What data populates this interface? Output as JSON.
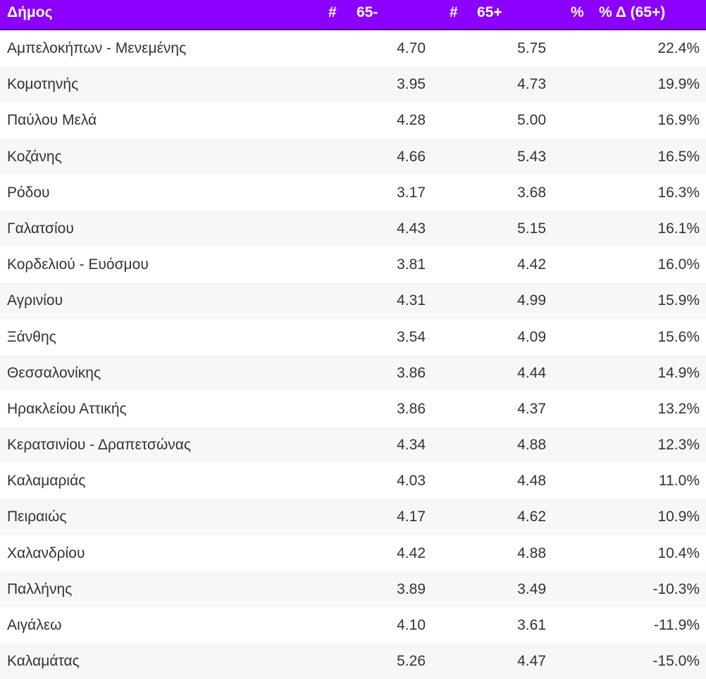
{
  "colors": {
    "header_bg": "#8b00ff",
    "header_text": "#ffffff",
    "row_alt": "#f6f7f9",
    "text": "#333333"
  },
  "chart_data": {
    "type": "table",
    "columns": [
      {
        "label": "Δήμος",
        "prefix": ""
      },
      {
        "label": "65-",
        "prefix": "#"
      },
      {
        "label": "65+",
        "prefix": "#"
      },
      {
        "label": "% Δ (65+)",
        "prefix": "%"
      }
    ],
    "rows": [
      {
        "name": "Αμπελοκήπων - Μενεμένης",
        "v1": "4.70",
        "v2": "5.75",
        "v3": "22.4%"
      },
      {
        "name": "Κομοτηνής",
        "v1": "3.95",
        "v2": "4.73",
        "v3": "19.9%"
      },
      {
        "name": "Παύλου Μελά",
        "v1": "4.28",
        "v2": "5.00",
        "v3": "16.9%"
      },
      {
        "name": "Κοζάνης",
        "v1": "4.66",
        "v2": "5.43",
        "v3": "16.5%"
      },
      {
        "name": "Ρόδου",
        "v1": "3.17",
        "v2": "3.68",
        "v3": "16.3%"
      },
      {
        "name": "Γαλατσίου",
        "v1": "4.43",
        "v2": "5.15",
        "v3": "16.1%"
      },
      {
        "name": "Κορδελιού - Ευόσμου",
        "v1": "3.81",
        "v2": "4.42",
        "v3": "16.0%"
      },
      {
        "name": "Αγρινίου",
        "v1": "4.31",
        "v2": "4.99",
        "v3": "15.9%"
      },
      {
        "name": "Ξάνθης",
        "v1": "3.54",
        "v2": "4.09",
        "v3": "15.6%"
      },
      {
        "name": "Θεσσαλονίκης",
        "v1": "3.86",
        "v2": "4.44",
        "v3": "14.9%"
      },
      {
        "name": "Ηρακλείου Αττικής",
        "v1": "3.86",
        "v2": "4.37",
        "v3": "13.2%"
      },
      {
        "name": "Κερατσινίου - Δραπετσώνας",
        "v1": "4.34",
        "v2": "4.88",
        "v3": "12.3%"
      },
      {
        "name": "Καλαμαριάς",
        "v1": "4.03",
        "v2": "4.48",
        "v3": "11.0%"
      },
      {
        "name": "Πειραιώς",
        "v1": "4.17",
        "v2": "4.62",
        "v3": "10.9%"
      },
      {
        "name": "Χαλανδρίου",
        "v1": "4.42",
        "v2": "4.88",
        "v3": "10.4%"
      },
      {
        "name": "Παλλήνης",
        "v1": "3.89",
        "v2": "3.49",
        "v3": "-10.3%"
      },
      {
        "name": "Αιγάλεω",
        "v1": "4.10",
        "v2": "3.61",
        "v3": "-11.9%"
      },
      {
        "name": "Καλαμάτας",
        "v1": "5.26",
        "v2": "4.47",
        "v3": "-15.0%"
      }
    ]
  }
}
